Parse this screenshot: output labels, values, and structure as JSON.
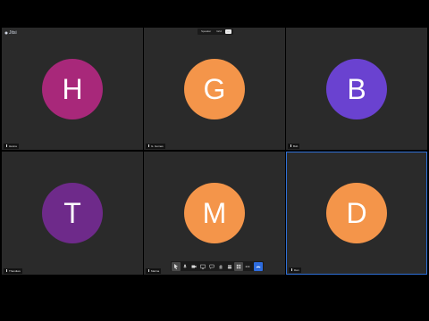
{
  "meeting": {
    "brand_label": "Jitsi",
    "view_options": [
      "Speaker",
      "Grid",
      "⋯"
    ]
  },
  "participants": [
    {
      "initial": "H",
      "name": "Hanna",
      "color": "#a8287a"
    },
    {
      "initial": "G",
      "name": "G. Gomes",
      "color": "#f4954a"
    },
    {
      "initial": "B",
      "name": "Bob",
      "color": "#6a42d0"
    },
    {
      "initial": "T",
      "name": "Thandiwe",
      "color": "#6e2a8a"
    },
    {
      "initial": "M",
      "name": "Marina",
      "color": "#f4954a"
    },
    {
      "initial": "D",
      "name": "Dan",
      "color": "#f4954a",
      "active": true
    }
  ],
  "toolbar": {
    "buttons": [
      {
        "icon": "pointer-icon"
      },
      {
        "icon": "mic-icon"
      },
      {
        "icon": "camera-icon"
      },
      {
        "icon": "screen-share-icon"
      },
      {
        "icon": "chat-icon"
      },
      {
        "icon": "raise-hand-icon"
      },
      {
        "icon": "participants-icon"
      },
      {
        "icon": "tile-view-icon"
      },
      {
        "icon": "more-icon"
      },
      {
        "icon": "leave-call-icon"
      }
    ]
  },
  "colors": {
    "tile_bg": "#2a2a2a",
    "active_border": "#2f6fd6",
    "end_button": "#2d6cdf"
  }
}
